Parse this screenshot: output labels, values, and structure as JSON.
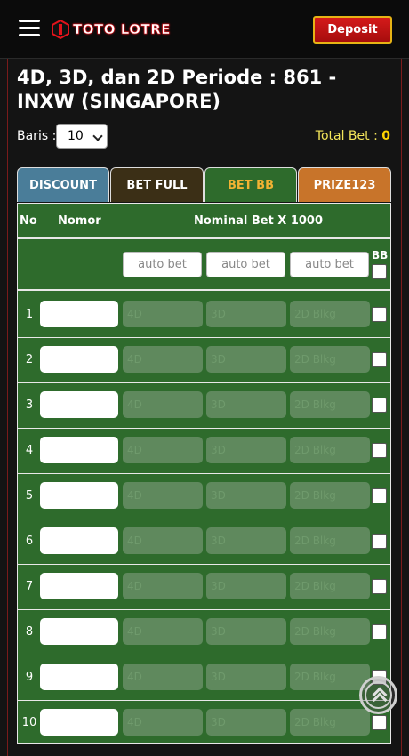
{
  "header": {
    "logo_text": "TOTO LOTRE",
    "deposit_label": "Deposit"
  },
  "page": {
    "title": "4D, 3D, dan 2D Periode : 861 - INXW (SINGAPORE)",
    "baris_label": "Baris :",
    "baris_value": "10",
    "total_bet_label": "Total Bet :",
    "total_bet_value": "0"
  },
  "tabs": [
    {
      "label": "DISCOUNT",
      "color": "#4a7d99"
    },
    {
      "label": "BET FULL",
      "color": "#3b2f16"
    },
    {
      "label": "BET BB",
      "color": "#2e6b2c",
      "active": true
    },
    {
      "label": "PRIZE123",
      "color": "#c8742a"
    }
  ],
  "table": {
    "col_no": "No",
    "col_nomor": "Nomor",
    "col_nominal": "Nominal Bet X 1000",
    "bb_label": "BB",
    "auto_placeholder": "auto bet",
    "bet_placeholders": [
      "4D",
      "3D",
      "2D Blkg"
    ],
    "rows": [
      "1",
      "2",
      "3",
      "4",
      "5",
      "6",
      "7",
      "8",
      "9",
      "10"
    ]
  }
}
